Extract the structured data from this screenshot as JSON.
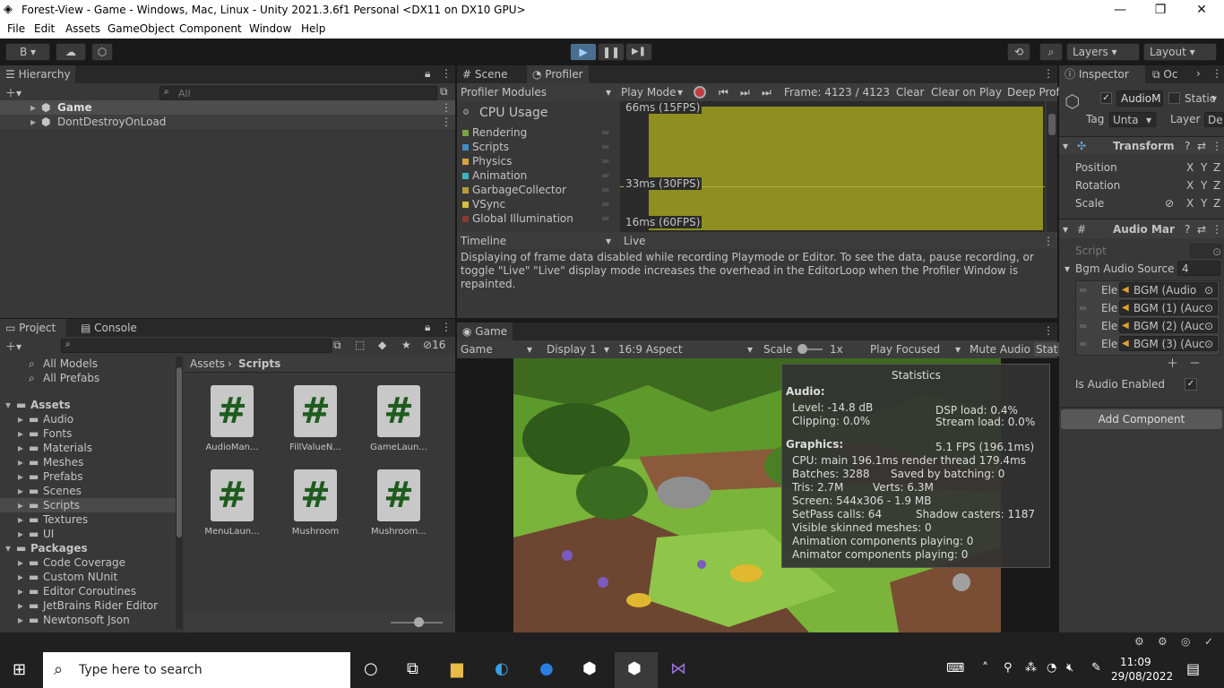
{
  "window": {
    "title": "Forest-View - Game - Windows, Mac, Linux - Unity 2021.3.6f1 Personal <DX11 on DX10 GPU>",
    "min": "—",
    "max": "❐",
    "close": "✕"
  },
  "menu": [
    "File",
    "Edit",
    "Assets",
    "GameObject",
    "Component",
    "Window",
    "Help"
  ],
  "toolbar": {
    "account": "B ▾",
    "play": "▶",
    "pause": "❚❚",
    "step": "▶❚",
    "layers": "Layers",
    "layout": "Layout"
  },
  "hierarchy": {
    "tab": "Hierarchy",
    "search_placeholder": "All",
    "items": [
      "Game",
      "DontDestroyOnLoad"
    ]
  },
  "project": {
    "tabs": [
      "Project",
      "Console"
    ],
    "count": "16",
    "favorites": [
      "All Models",
      "All Prefabs"
    ],
    "tree": [
      {
        "label": "Assets",
        "level": 0
      },
      {
        "label": "Audio",
        "level": 1
      },
      {
        "label": "Fonts",
        "level": 1
      },
      {
        "label": "Materials",
        "level": 1
      },
      {
        "label": "Meshes",
        "level": 1
      },
      {
        "label": "Prefabs",
        "level": 1
      },
      {
        "label": "Scenes",
        "level": 1
      },
      {
        "label": "Scripts",
        "level": 1
      },
      {
        "label": "Textures",
        "level": 1
      },
      {
        "label": "UI",
        "level": 1
      },
      {
        "label": "Packages",
        "level": 0
      },
      {
        "label": "Code Coverage",
        "level": 1
      },
      {
        "label": "Custom NUnit",
        "level": 1
      },
      {
        "label": "Editor Coroutines",
        "level": 1
      },
      {
        "label": "JetBrains Rider Editor",
        "level": 1
      },
      {
        "label": "Newtonsoft Json",
        "level": 1
      }
    ],
    "breadcrumb": [
      "Assets",
      "Scripts"
    ],
    "files": [
      "AudioMan...",
      "FillValueN...",
      "GameLaun...",
      "MenuLaun...",
      "Mushroom",
      "Mushroom..."
    ],
    "hash": "#"
  },
  "profiler": {
    "tabs": [
      "Scene",
      "Profiler"
    ],
    "modules": "Profiler Modules",
    "mode": "Play Mode",
    "frame": "Frame: 4123 / 4123",
    "clear": "Clear",
    "clear_on_play": "Clear on Play",
    "deep": "Deep Prof",
    "cpu": "CPU Usage",
    "legend": [
      {
        "name": "Rendering",
        "color": "#7ea43d"
      },
      {
        "name": "Scripts",
        "color": "#3b8ecb"
      },
      {
        "name": "Physics",
        "color": "#d8a33a"
      },
      {
        "name": "Animation",
        "color": "#3eb5c5"
      },
      {
        "name": "GarbageCollector",
        "color": "#b99d36"
      },
      {
        "name": "VSync",
        "color": "#d4be3e"
      },
      {
        "name": "Global Illumination",
        "color": "#8c3a30"
      }
    ],
    "marks": [
      "66ms (15FPS)",
      "33ms (30FPS)",
      "16ms (60FPS)"
    ],
    "timeline": "Timeline",
    "live": "Live",
    "message": "Displaying of frame data disabled while recording Playmode or Editor. To see the data, pause recording, or toggle \"Live\" \"Live\" display mode increases the overhead in the EditorLoop when the Profiler Window is repainted."
  },
  "game": {
    "tab": "Game",
    "display_mode": "Game",
    "display": "Display 1",
    "aspect": "16:9 Aspect",
    "scale_label": "Scale",
    "scale": "1x",
    "play_focused": "Play Focused",
    "mute": "Mute Audio",
    "stats": "Stat"
  },
  "statistics": {
    "title": "Statistics",
    "audio": "Audio:",
    "level": "Level: -14.8 dB",
    "dsp": "DSP load: 0.4%",
    "clipping": "Clipping: 0.0%",
    "stream": "Stream load: 0.0%",
    "graphics": "Graphics:",
    "fps": "5.1 FPS (196.1ms)",
    "cpu": "CPU: main 196.1ms  render thread 179.4ms",
    "batches": "Batches: 3288",
    "saved": "Saved by batching: 0",
    "tris": "Tris: 2.7M",
    "verts": "Verts: 6.3M",
    "screen": "Screen: 544x306 - 1.9 MB",
    "setpass": "SetPass calls: 64",
    "shadow": "Shadow casters: 1187",
    "skinned": "Visible skinned meshes: 0",
    "anim": "Animation components playing: 0",
    "animator": "Animator components playing: 0"
  },
  "inspector": {
    "tabs": [
      "Inspector",
      "Oc"
    ],
    "object": "AudioM",
    "static": "Static",
    "tag_label": "Tag",
    "tag": "Unta",
    "layer_label": "Layer",
    "layer": "De",
    "transform": "Transform",
    "position": "Position",
    "rotation": "Rotation",
    "scale": "Scale",
    "xyz": [
      "X",
      "Y",
      "Z"
    ],
    "component": "Audio Mar",
    "script": "Script",
    "bgm_label": "Bgm Audio Source",
    "bgm_count": "4",
    "elements": [
      {
        "label": "Ele",
        "value": "BGM (Audio"
      },
      {
        "label": "Ele",
        "value": "BGM (1) (Auc"
      },
      {
        "label": "Ele",
        "value": "BGM (2) (Auc"
      },
      {
        "label": "Ele",
        "value": "BGM (3) (Auc"
      }
    ],
    "audio_enabled": "Is Audio Enabled",
    "add_component": "Add Component"
  },
  "taskbar": {
    "search": "Type here to search",
    "time": "11:09",
    "date": "29/08/2022"
  },
  "colors": {
    "accent": "#2c5d87",
    "graph": "#8f8f21",
    "panel": "#383838"
  }
}
